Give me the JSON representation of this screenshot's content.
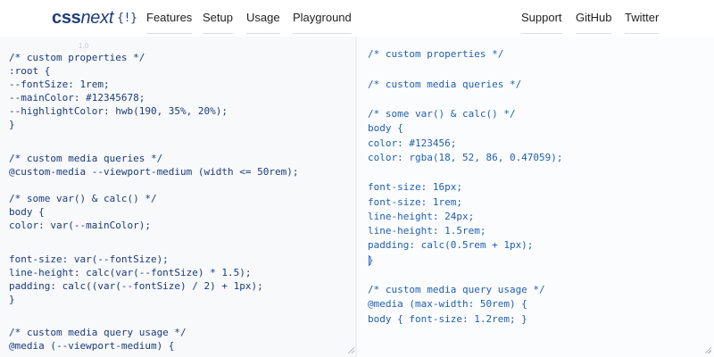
{
  "nav": {
    "logo": {
      "bold": "css",
      "italic": "next",
      "brace": "{!}"
    },
    "links": [
      "Features",
      "Setup",
      "Usage",
      "Playground"
    ],
    "right_links": [
      "Support",
      "GitHub",
      "Twitter"
    ]
  },
  "editor": {
    "hint": "1.0",
    "input_lines": [
      "/* custom properties */",
      ":root {",
      "--fontSize: 1rem;",
      "--mainColor: #12345678;",
      "--highlightColor: hwb(190, 35%, 20%);",
      "}",
      "",
      "/* custom media queries */",
      "@custom-media --viewport-medium (width <= 50rem);",
      "",
      "/* some var() & calc() */",
      "body {",
      "color: var(--mainColor);",
      "",
      "font-size: var(--fontSize);",
      "line-height: calc(var(--fontSize) * 1.5);",
      "padding: calc((var(--fontSize) / 2) + 1px);",
      "}",
      "",
      "/* custom media query usage */",
      "@media (--viewport-medium) {"
    ],
    "output_lines": [
      "/* custom properties */",
      "",
      "/* custom media queries */",
      "",
      "/* some var() & calc() */",
      "body {",
      "color: #123456;",
      "color: rgba(18, 52, 86, 0.47059);",
      "",
      "font-size: 16px;",
      "font-size: 1rem;",
      "line-height: 24px;",
      "line-height: 1.5rem;",
      "padding: calc(0.5rem + 1px);",
      "}",
      "",
      "/* custom media query usage */",
      "@media (max-width: 50rem) {",
      "body { font-size: 1.2rem; }"
    ]
  }
}
